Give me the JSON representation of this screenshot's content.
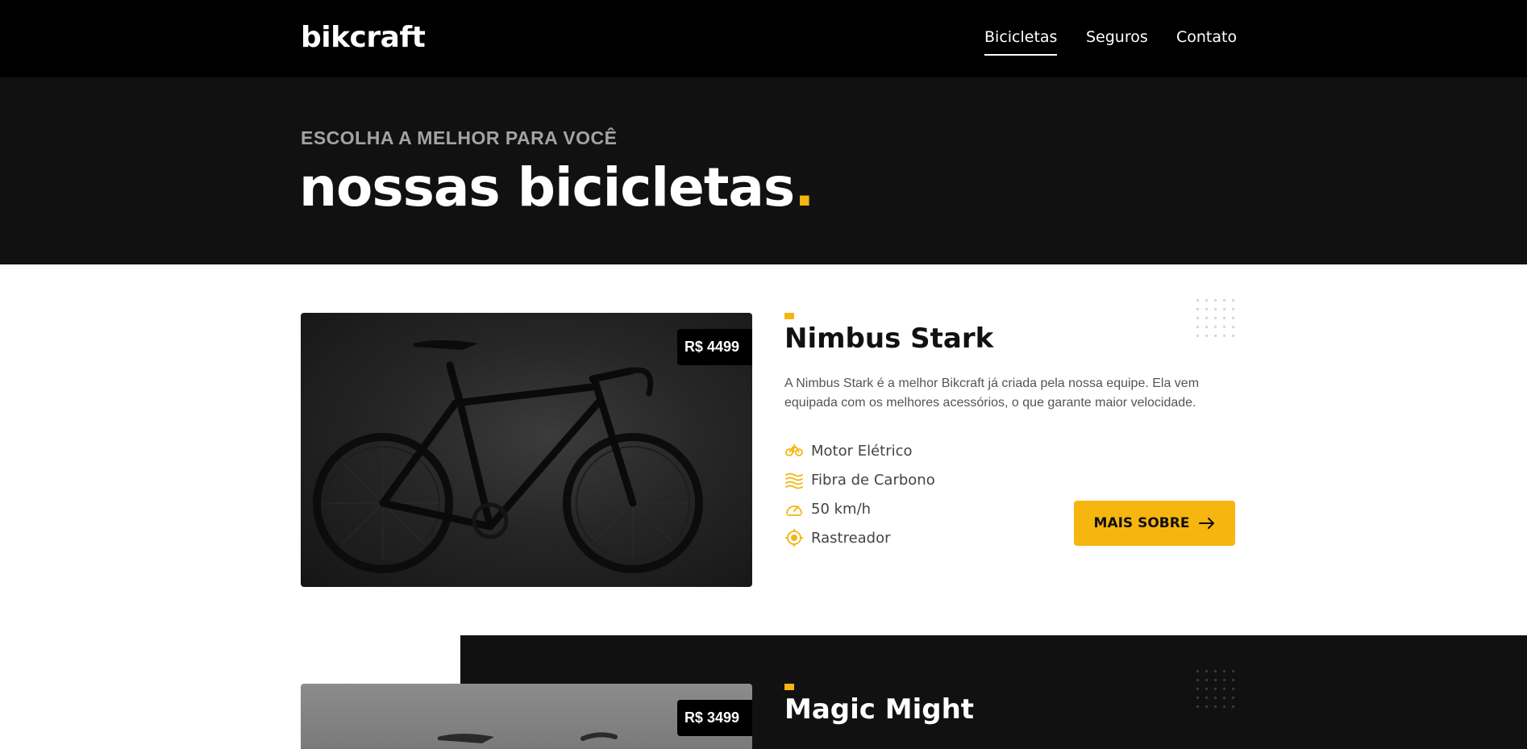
{
  "header": {
    "logo": "bikcraft",
    "nav": [
      {
        "label": "Bicicletas",
        "active": true
      },
      {
        "label": "Seguros",
        "active": false
      },
      {
        "label": "Contato",
        "active": false
      }
    ]
  },
  "intro": {
    "kicker": "ESCOLHA A MELHOR PARA VOCÊ",
    "title": "nossas bicicletas",
    "title_dot": "."
  },
  "products": [
    {
      "name": "Nimbus Stark",
      "price": "R$ 4499",
      "description": "A Nimbus Stark é a melhor Bikcraft já criada pela nossa equipe. Ela vem equipada com os melhores acessórios, o que garante maior velocidade.",
      "features": [
        {
          "label": "Motor Elétrico",
          "icon": "electric-icon"
        },
        {
          "label": "Fibra de Carbono",
          "icon": "carbon-icon"
        },
        {
          "label": "50 km/h",
          "icon": "speed-icon"
        },
        {
          "label": "Rastreador",
          "icon": "tracker-icon"
        }
      ],
      "button_label": "MAIS SOBRE"
    },
    {
      "name": "Magic Might",
      "price": "R$ 3499"
    }
  ],
  "colors": {
    "accent": "#f5b40f",
    "header_bg": "#000000",
    "section_bg": "#111111"
  }
}
